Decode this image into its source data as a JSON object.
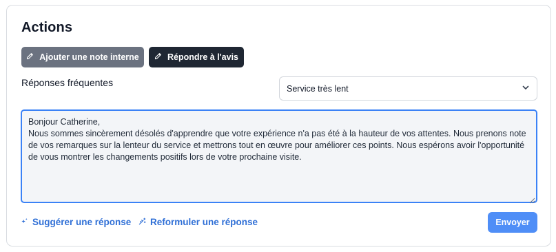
{
  "panel": {
    "title": "Actions"
  },
  "buttons": {
    "internal_note": "Ajouter une note interne",
    "reply_review": "Répondre à l'avis",
    "send": "Envoyer"
  },
  "frequent_responses": {
    "label": "Réponses fréquentes",
    "selected": "Service très lent"
  },
  "response_text": "Bonjour Catherine,\nNous sommes sincèrement désolés d'apprendre que votre expérience n'a pas été à la hauteur de vos attentes. Nous prenons note de vos remarques sur la lenteur du service et mettrons tout en œuvre pour améliorer ces points. Nous espérons avoir l'opportunité de vous montrer les changements positifs lors de votre prochaine visite.",
  "links": {
    "suggest": "Suggérer une réponse",
    "rephrase": "Reformuler une réponse"
  },
  "icons": {
    "pencil": "pencil-icon",
    "chevron": "chevron-down-icon",
    "sparkle": "sparkle-icon",
    "wand": "magic-wand-icon",
    "resize": "resize-handle-icon"
  },
  "colors": {
    "accent_blue": "#3b82f6",
    "link_blue": "#2f6fd6",
    "send_button": "#4f8ef7",
    "dark_button": "#1f2733",
    "gray_button": "#6b7280"
  }
}
